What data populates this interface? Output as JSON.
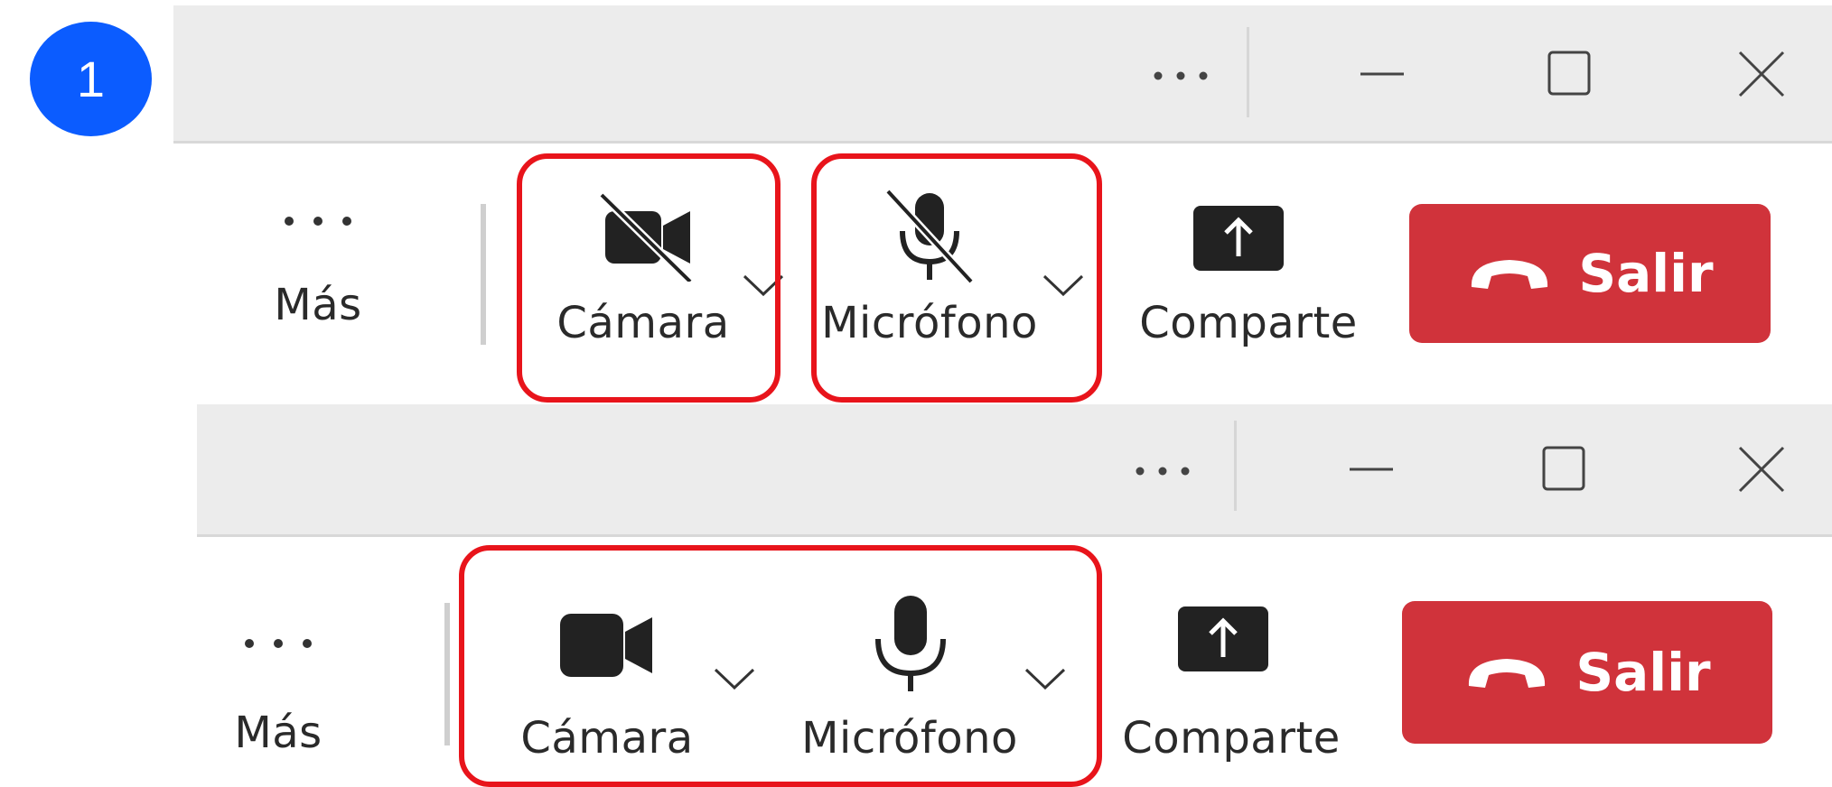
{
  "step_number": "1",
  "colors": {
    "step_badge": "#0b5cff",
    "leave_button": "#d0333b",
    "highlight": "#e8141b",
    "titlebar": "#ececec"
  },
  "panels": [
    {
      "state": "muted",
      "toolbar": {
        "more_label": "Más",
        "camera_label": "Cámara",
        "camera_icon": "camera-off-icon",
        "mic_label": "Micrófono",
        "mic_icon": "microphone-off-icon",
        "share_label": "Comparte",
        "leave_label": "Salir"
      }
    },
    {
      "state": "unmuted",
      "toolbar": {
        "more_label": "Más",
        "camera_label": "Cámara",
        "camera_icon": "camera-icon",
        "mic_label": "Micrófono",
        "mic_icon": "microphone-icon",
        "share_label": "Comparte",
        "leave_label": "Salir"
      }
    }
  ]
}
